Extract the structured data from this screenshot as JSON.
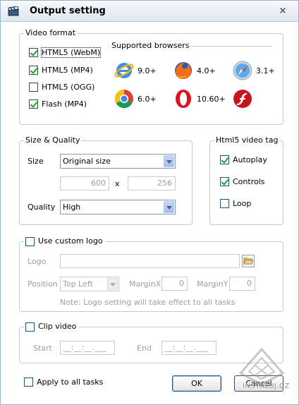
{
  "window": {
    "title": "Output setting",
    "close_glyph": "×"
  },
  "video_format": {
    "legend": "Video format",
    "options": [
      {
        "label": "HTML5 (WebM)",
        "checked": true
      },
      {
        "label": "HTML5 (MP4)",
        "checked": true
      },
      {
        "label": "HTML5 (OGG)",
        "checked": false
      },
      {
        "label": "Flash (MP4)",
        "checked": true
      }
    ],
    "browsers_heading": "Supported browsers",
    "browsers": [
      {
        "icon": "internet-explorer-icon",
        "version": "9.0+"
      },
      {
        "icon": "firefox-icon",
        "version": "4.0+"
      },
      {
        "icon": "safari-icon",
        "version": "3.1+"
      },
      {
        "icon": "chrome-icon",
        "version": "6.0+"
      },
      {
        "icon": "opera-icon",
        "version": "10.60+"
      },
      {
        "icon": "flash-player-icon",
        "version": ""
      }
    ]
  },
  "size_quality": {
    "legend": "Size & Quality",
    "size_label": "Size",
    "size_value": "Original size",
    "width": "600",
    "x_sep": "x",
    "height": "256",
    "quality_label": "Quality",
    "quality_value": "High"
  },
  "html5_tag": {
    "legend": "Html5 video tag",
    "autoplay": {
      "label": "Autoplay",
      "checked": true
    },
    "controls": {
      "label": "Controls",
      "checked": true
    },
    "loop": {
      "label": "Loop",
      "checked": false
    }
  },
  "custom_logo": {
    "legend": "Use custom logo",
    "checked": false,
    "logo_label": "Logo",
    "logo_path": "",
    "position_label": "Position",
    "position_value": "Top Left",
    "marginx_label": "MarginX",
    "marginx_value": "0",
    "marginy_label": "MarginY",
    "marginy_value": "0",
    "note": "Note: Logo setting will take effect to all tasks"
  },
  "clip_video": {
    "legend": "Clip video",
    "checked": false,
    "start_label": "Start",
    "start_value": "__:__:__.___",
    "end_label": "End",
    "end_value": "__:__:__.___"
  },
  "footer": {
    "apply_all": {
      "label": "Apply to all tasks",
      "checked": false
    },
    "ok_label": "OK",
    "cancel_label": "Cancel"
  },
  "watermark": {
    "text": "INSTALUJ.CZ"
  },
  "colors": {
    "title_bg": "#dfe7f1",
    "border": "#c5ccd6",
    "check": "#21a121",
    "disabled_text": "#9aa0a6"
  }
}
